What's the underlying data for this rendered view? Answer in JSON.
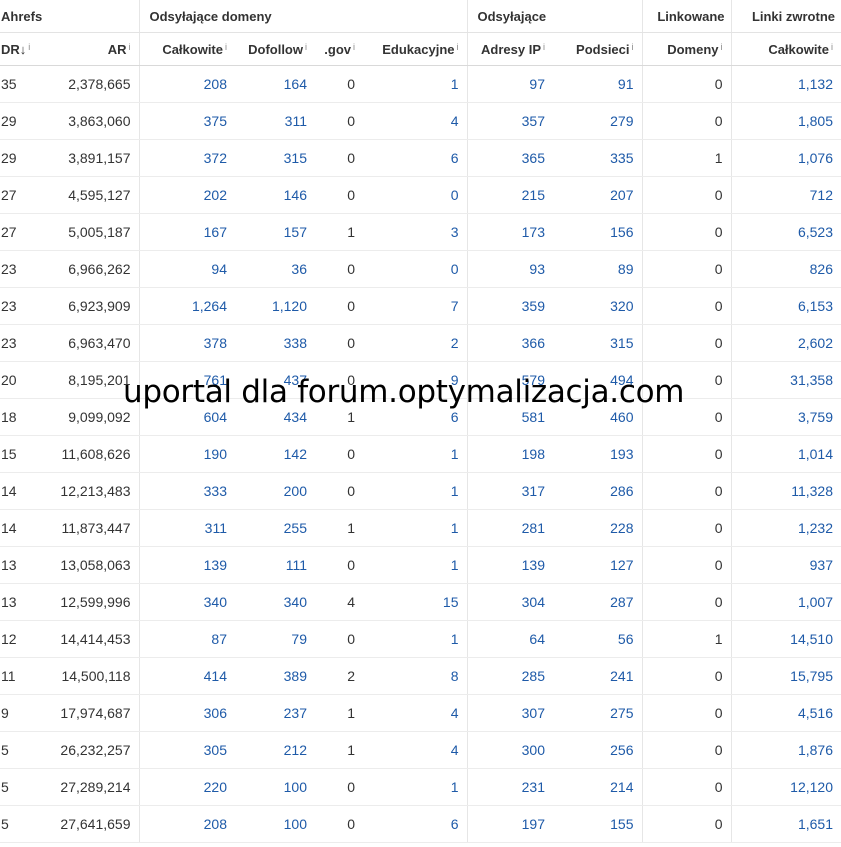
{
  "groups": [
    "Ahrefs",
    "Odsyłające domeny",
    "Odsyłające",
    "Linkowane",
    "Linki zwrotne"
  ],
  "columns": [
    {
      "label": "DR",
      "sort": "↓",
      "info": "i"
    },
    {
      "label": "AR",
      "info": "i"
    },
    {
      "label": "Całkowite",
      "info": "i"
    },
    {
      "label": "Dofollow",
      "info": "i"
    },
    {
      "label": ".gov",
      "info": "i"
    },
    {
      "label": "Edukacyjne",
      "info": "i"
    },
    {
      "label": "Adresy IP",
      "info": "i"
    },
    {
      "label": "Podsieci",
      "info": "i"
    },
    {
      "label": "Domeny",
      "info": "i"
    },
    {
      "label": "Całkowite",
      "info": "i"
    }
  ],
  "rows": [
    [
      "35",
      "2,378,665",
      "208",
      "164",
      "0",
      "1",
      "97",
      "91",
      "0",
      "1,132"
    ],
    [
      "29",
      "3,863,060",
      "375",
      "311",
      "0",
      "4",
      "357",
      "279",
      "0",
      "1,805"
    ],
    [
      "29",
      "3,891,157",
      "372",
      "315",
      "0",
      "6",
      "365",
      "335",
      "1",
      "1,076"
    ],
    [
      "27",
      "4,595,127",
      "202",
      "146",
      "0",
      "0",
      "215",
      "207",
      "0",
      "712"
    ],
    [
      "27",
      "5,005,187",
      "167",
      "157",
      "1",
      "3",
      "173",
      "156",
      "0",
      "6,523"
    ],
    [
      "23",
      "6,966,262",
      "94",
      "36",
      "0",
      "0",
      "93",
      "89",
      "0",
      "826"
    ],
    [
      "23",
      "6,923,909",
      "1,264",
      "1,120",
      "0",
      "7",
      "359",
      "320",
      "0",
      "6,153"
    ],
    [
      "23",
      "6,963,470",
      "378",
      "338",
      "0",
      "2",
      "366",
      "315",
      "0",
      "2,602"
    ],
    [
      "20",
      "8,195,201",
      "761",
      "437",
      "0",
      "9",
      "579",
      "494",
      "0",
      "31,358"
    ],
    [
      "18",
      "9,099,092",
      "604",
      "434",
      "1",
      "6",
      "581",
      "460",
      "0",
      "3,759"
    ],
    [
      "15",
      "11,608,626",
      "190",
      "142",
      "0",
      "1",
      "198",
      "193",
      "0",
      "1,014"
    ],
    [
      "14",
      "12,213,483",
      "333",
      "200",
      "0",
      "1",
      "317",
      "286",
      "0",
      "11,328"
    ],
    [
      "14",
      "11,873,447",
      "311",
      "255",
      "1",
      "1",
      "281",
      "228",
      "0",
      "1,232"
    ],
    [
      "13",
      "13,058,063",
      "139",
      "111",
      "0",
      "1",
      "139",
      "127",
      "0",
      "937"
    ],
    [
      "13",
      "12,599,996",
      "340",
      "340",
      "4",
      "15",
      "304",
      "287",
      "0",
      "1,007"
    ],
    [
      "12",
      "14,414,453",
      "87",
      "79",
      "0",
      "1",
      "64",
      "56",
      "1",
      "14,510"
    ],
    [
      "11",
      "14,500,118",
      "414",
      "389",
      "2",
      "8",
      "285",
      "241",
      "0",
      "15,795"
    ],
    [
      "9",
      "17,974,687",
      "306",
      "237",
      "1",
      "4",
      "307",
      "275",
      "0",
      "4,516"
    ],
    [
      "5",
      "26,232,257",
      "305",
      "212",
      "1",
      "4",
      "300",
      "256",
      "0",
      "1,876"
    ],
    [
      "5",
      "27,289,214",
      "220",
      "100",
      "0",
      "1",
      "231",
      "214",
      "0",
      "12,120"
    ],
    [
      "5",
      "27,641,659",
      "208",
      "100",
      "0",
      "6",
      "197",
      "155",
      "0",
      "1,651"
    ]
  ],
  "watermark": "uportal dla forum.optymalizacja.com",
  "colors": {
    "link": "#1e5aa8",
    "text": "#333333",
    "border": "#e3e3e3"
  }
}
